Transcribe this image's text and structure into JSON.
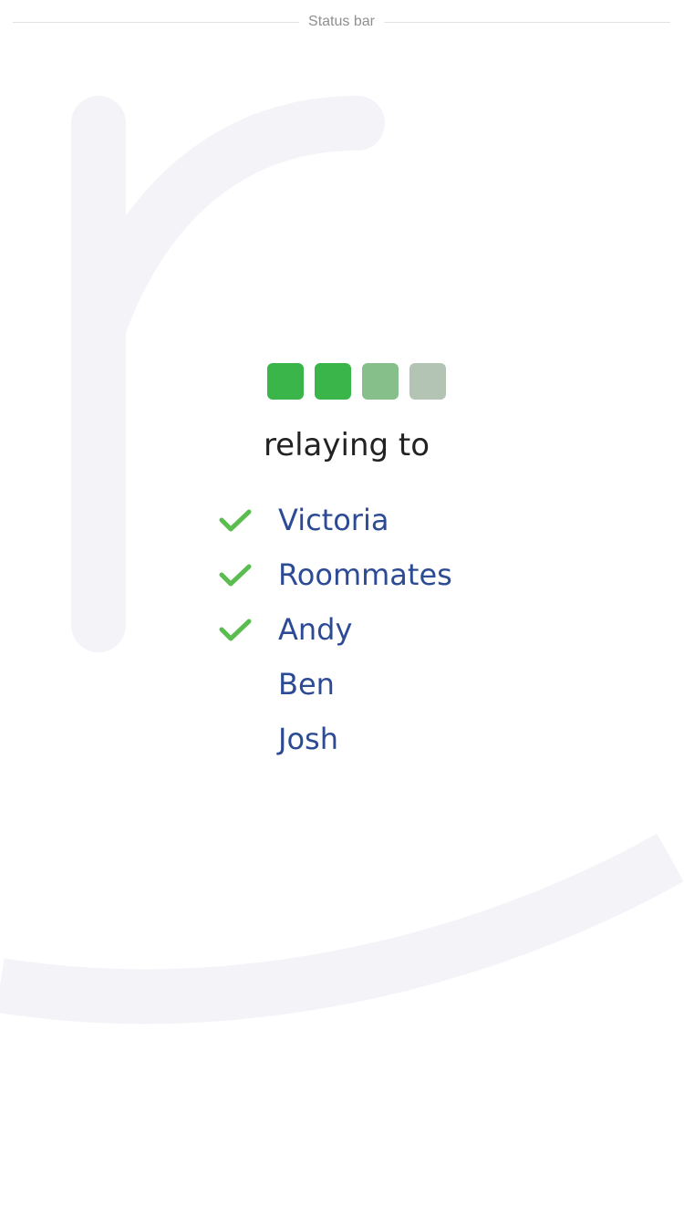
{
  "status_bar": {
    "label": "Status bar"
  },
  "progress": {
    "total_steps": 4,
    "completed_steps": 2,
    "colors": [
      "#39b54a",
      "#39b54a",
      "#86bf8a",
      "#b3c4b5"
    ]
  },
  "heading": "relaying to",
  "recipients": [
    {
      "name": "Victoria",
      "delivered": true
    },
    {
      "name": "Roommates",
      "delivered": true
    },
    {
      "name": "Andy",
      "delivered": true
    },
    {
      "name": "Ben",
      "delivered": false
    },
    {
      "name": "Josh",
      "delivered": false
    }
  ],
  "theme": {
    "accent_green": "#5bbc4f",
    "name_blue": "#2d4b95",
    "watermark": "#f4f4f8"
  }
}
